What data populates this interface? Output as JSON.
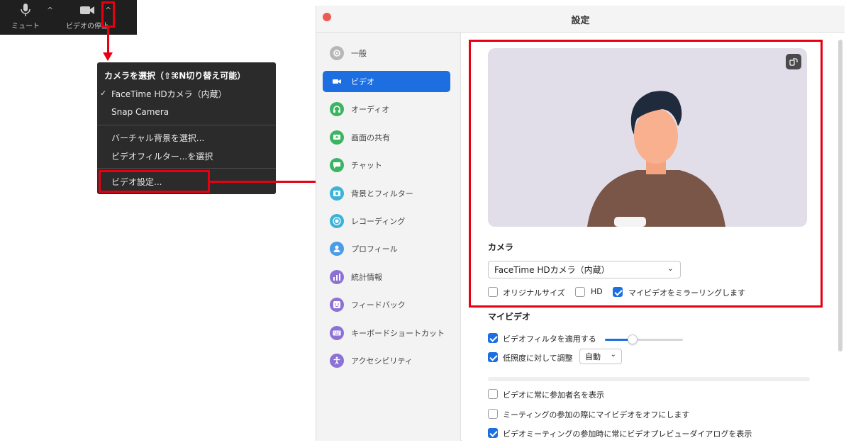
{
  "toolbar": {
    "mute_label": "ミュート",
    "video_label": "ビデオの停止",
    "caret": "^"
  },
  "camera_menu": {
    "header": "カメラを選択（⇧⌘N切り替え可能）",
    "checkmark": "✓",
    "items": [
      {
        "label": "FaceTime HDカメラ（内蔵）",
        "checked": true
      },
      {
        "label": "Snap Camera",
        "checked": false
      },
      {
        "label": "バーチャル背景を選択..."
      },
      {
        "label": "ビデオフィルター...を選択"
      },
      {
        "label": "ビデオ設定..."
      }
    ]
  },
  "window": {
    "title": "設定"
  },
  "sidebar": {
    "items": [
      {
        "label": "一般",
        "icon": "gear-icon",
        "color": "#b7b7b7"
      },
      {
        "label": "ビデオ",
        "icon": "video-camera-icon",
        "color": "#1d6fe1",
        "active": true
      },
      {
        "label": "オーディオ",
        "icon": "headphones-icon",
        "color": "#3cb562"
      },
      {
        "label": "画面の共有",
        "icon": "share-screen-icon",
        "color": "#3cb562"
      },
      {
        "label": "チャット",
        "icon": "chat-bubble-icon",
        "color": "#3cb562"
      },
      {
        "label": "背景とフィルター",
        "icon": "background-icon",
        "color": "#3bb3d9"
      },
      {
        "label": "レコーディング",
        "icon": "record-icon",
        "color": "#3bb3d9"
      },
      {
        "label": "プロフィール",
        "icon": "profile-icon",
        "color": "#4a9be8"
      },
      {
        "label": "統計情報",
        "icon": "statistics-icon",
        "color": "#8b72d4"
      },
      {
        "label": "フィードバック",
        "icon": "feedback-icon",
        "color": "#8b72d4"
      },
      {
        "label": "キーボードショートカット",
        "icon": "keyboard-icon",
        "color": "#8b72d4"
      },
      {
        "label": "アクセシビリティ",
        "icon": "accessibility-icon",
        "color": "#8b72d4"
      }
    ]
  },
  "video": {
    "camera_label": "カメラ",
    "camera_value": "FaceTime HDカメラ（内蔵）",
    "original_size_label": "オリジナルサイズ",
    "original_size_checked": false,
    "hd_label": "HD",
    "hd_checked": false,
    "mirror_label": "マイビデオをミラーリングします",
    "mirror_checked": true,
    "my_video_label": "マイビデオ",
    "filter_label": "ビデオフィルタを適用する",
    "filter_checked": true,
    "filter_level": 0.35,
    "low_light_label": "低照度に対して調整",
    "low_light_checked": true,
    "low_light_value": "自動",
    "show_names_label": "ビデオに常に参加者名を表示",
    "show_names_checked": false,
    "turn_off_label": "ミーティングの参加の際にマイビデオをオフにします",
    "turn_off_checked": false,
    "preview_dialog_label": "ビデオミーティングの参加時に常にビデオプレビューダイアログを表示",
    "preview_dialog_checked": true
  },
  "colors": {
    "highlight_red": "#e60012",
    "accent_blue": "#1d6fe1"
  }
}
